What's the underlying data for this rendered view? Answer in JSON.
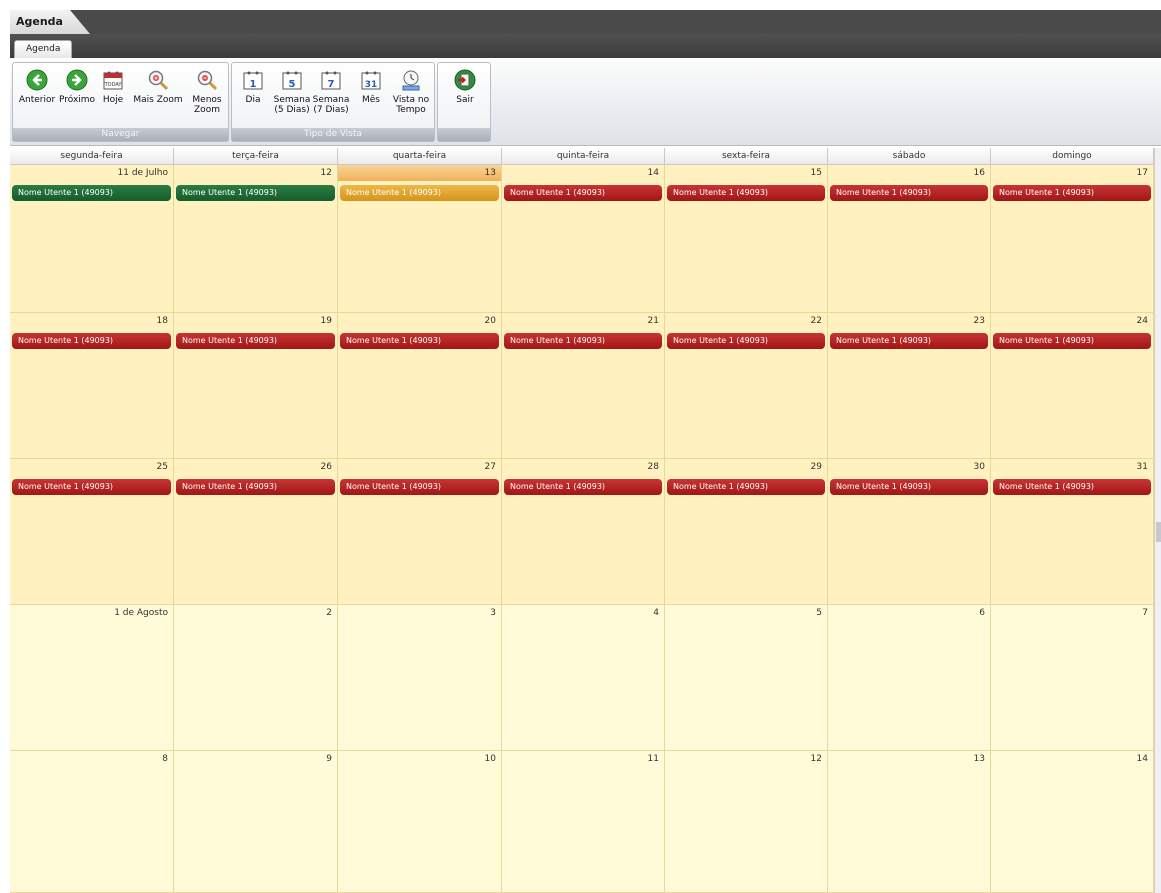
{
  "window": {
    "title": "Agenda"
  },
  "tabs": [
    {
      "label": "Agenda"
    }
  ],
  "ribbon": {
    "groups": [
      {
        "caption": "Navegar",
        "buttons": [
          {
            "label": "Anterior",
            "icon": "arrow-left-icon"
          },
          {
            "label": "Próximo",
            "icon": "arrow-right-icon"
          },
          {
            "label": "Hoje",
            "icon": "calendar-today-icon"
          },
          {
            "label": "Mais Zoom",
            "icon": "zoom-in-icon"
          },
          {
            "label": "Menos\nZoom",
            "icon": "zoom-out-icon"
          }
        ]
      },
      {
        "caption": "Tipo de Vista",
        "buttons": [
          {
            "label": "Dia",
            "icon": "calendar-day-icon"
          },
          {
            "label": "Semana\n(5 Dias)",
            "icon": "calendar-week5-icon"
          },
          {
            "label": "Semana\n(7 Dias)",
            "icon": "calendar-week7-icon"
          },
          {
            "label": "Mês",
            "icon": "calendar-month-icon"
          },
          {
            "label": "Vista no\nTempo",
            "icon": "timeline-icon"
          }
        ]
      },
      {
        "caption": "",
        "buttons": [
          {
            "label": "Sair",
            "icon": "exit-icon"
          }
        ]
      }
    ]
  },
  "calendar": {
    "weekdays": [
      "segunda-feira",
      "terça-feira",
      "quarta-feira",
      "quinta-feira",
      "sexta-feira",
      "sábado",
      "domingo"
    ],
    "weeks": [
      [
        {
          "day": "11 de Julho",
          "event": "Nome Utente 1 (49093)",
          "color": "green"
        },
        {
          "day": "12",
          "event": "Nome Utente 1 (49093)",
          "color": "green"
        },
        {
          "day": "13",
          "event": "Nome Utente 1 (49093)",
          "color": "orange",
          "today": true
        },
        {
          "day": "14",
          "event": "Nome Utente 1 (49093)",
          "color": "red"
        },
        {
          "day": "15",
          "event": "Nome Utente 1 (49093)",
          "color": "red"
        },
        {
          "day": "16",
          "event": "Nome Utente 1 (49093)",
          "color": "red"
        },
        {
          "day": "17",
          "event": "Nome Utente 1 (49093)",
          "color": "red"
        }
      ],
      [
        {
          "day": "18",
          "event": "Nome Utente 1 (49093)",
          "color": "red"
        },
        {
          "day": "19",
          "event": "Nome Utente 1 (49093)",
          "color": "red"
        },
        {
          "day": "20",
          "event": "Nome Utente 1 (49093)",
          "color": "red"
        },
        {
          "day": "21",
          "event": "Nome Utente 1 (49093)",
          "color": "red"
        },
        {
          "day": "22",
          "event": "Nome Utente 1 (49093)",
          "color": "red"
        },
        {
          "day": "23",
          "event": "Nome Utente 1 (49093)",
          "color": "red"
        },
        {
          "day": "24",
          "event": "Nome Utente 1 (49093)",
          "color": "red"
        }
      ],
      [
        {
          "day": "25",
          "event": "Nome Utente 1 (49093)",
          "color": "red"
        },
        {
          "day": "26",
          "event": "Nome Utente 1 (49093)",
          "color": "red"
        },
        {
          "day": "27",
          "event": "Nome Utente 1 (49093)",
          "color": "red"
        },
        {
          "day": "28",
          "event": "Nome Utente 1 (49093)",
          "color": "red"
        },
        {
          "day": "29",
          "event": "Nome Utente 1 (49093)",
          "color": "red"
        },
        {
          "day": "30",
          "event": "Nome Utente 1 (49093)",
          "color": "red"
        },
        {
          "day": "31",
          "event": "Nome Utente 1 (49093)",
          "color": "red"
        }
      ],
      [
        {
          "day": "1 de Agosto",
          "next": true
        },
        {
          "day": "2",
          "next": true
        },
        {
          "day": "3",
          "next": true
        },
        {
          "day": "4",
          "next": true
        },
        {
          "day": "5",
          "next": true
        },
        {
          "day": "6",
          "next": true
        },
        {
          "day": "7",
          "next": true
        }
      ],
      [
        {
          "day": "8",
          "next": true
        },
        {
          "day": "9",
          "next": true
        },
        {
          "day": "10",
          "next": true
        },
        {
          "day": "11",
          "next": true
        },
        {
          "day": "12",
          "next": true
        },
        {
          "day": "13",
          "next": true
        },
        {
          "day": "14",
          "next": true
        }
      ]
    ]
  },
  "colors": {
    "cell": "#fff2c0",
    "cell_next_month": "#fffbd9",
    "event_red": "#b52020",
    "event_green": "#1d6b34",
    "event_orange": "#e2a32e",
    "today_header": "#f4c073"
  }
}
